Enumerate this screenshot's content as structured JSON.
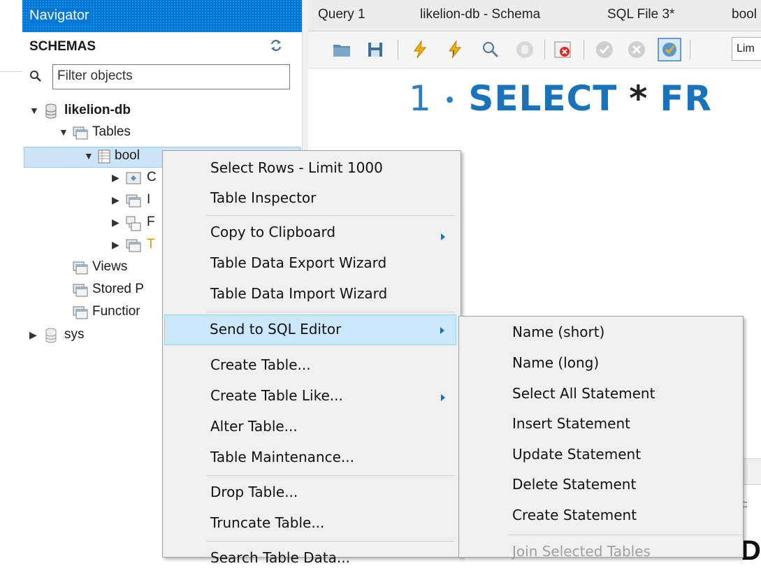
{
  "navigator": {
    "header": "Navigator",
    "schemas_title": "SCHEMAS",
    "filter_placeholder": "Filter objects",
    "tree": {
      "db1": "likelion-db",
      "tables": "Tables",
      "table_book": "bool",
      "child1": "C",
      "child2": "I",
      "child3": "F",
      "child4": "T",
      "views": "Views",
      "stored": "Stored P",
      "functions": "Functior",
      "db2": "sys"
    }
  },
  "tabs": [
    "Query 1",
    "likelion-db - Schema",
    "SQL File 3*",
    "bool"
  ],
  "toolbar": {
    "limit_text": "Lim"
  },
  "editor": {
    "line_number": "1",
    "line_code_kw": "SELECT",
    "line_code_star": "*",
    "line_code_tail": "FR"
  },
  "bottom": {
    "label": "it:",
    "big": "D"
  },
  "context_menu": {
    "items": [
      "Select Rows - Limit 1000",
      "Table Inspector",
      "Copy to Clipboard",
      "Table Data Export Wizard",
      "Table Data Import Wizard",
      "Send to SQL Editor",
      "Create Table...",
      "Create Table Like...",
      "Alter Table...",
      "Table Maintenance...",
      "Drop Table...",
      "Truncate Table...",
      "Search Table Data..."
    ]
  },
  "submenu": {
    "items": [
      "Name (short)",
      "Name (long)",
      "Select All Statement",
      "Insert Statement",
      "Update Statement",
      "Delete Statement",
      "Create Statement",
      "Join Selected Tables"
    ]
  },
  "colors": {
    "accent": "#0078d7",
    "highlight": "#cce8ff",
    "keyword": "#1a73b9"
  }
}
